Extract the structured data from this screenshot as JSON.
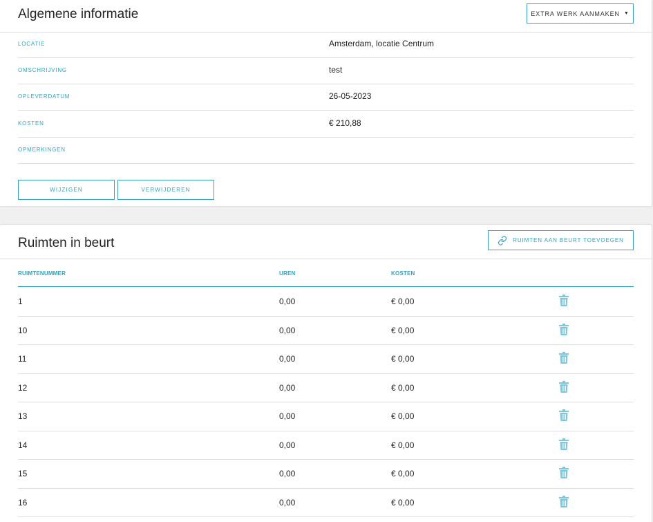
{
  "info": {
    "title": "Algemene informatie",
    "extra_button": "EXTRA WERK AANMAKEN",
    "rows": [
      {
        "label": "LOCATIE",
        "value": "Amsterdam, locatie Centrum"
      },
      {
        "label": "OMSCHRIJVING",
        "value": "test"
      },
      {
        "label": "OPLEVERDATUM",
        "value": "26-05-2023"
      },
      {
        "label": "KOSTEN",
        "value": "€ 210,88"
      },
      {
        "label": "OPMERKINGEN",
        "value": ""
      }
    ],
    "edit_button": "WIJZIGEN",
    "delete_button": "VERWIJDEREN"
  },
  "rooms": {
    "title": "Ruimten in beurt",
    "add_button": "RUIMTEN AAN BEURT TOEVOEGEN",
    "columns": [
      "RUIMTENUMMER",
      "UREN",
      "KOSTEN"
    ],
    "rows": [
      {
        "number": "1",
        "hours": "0,00",
        "cost": "€ 0,00"
      },
      {
        "number": "10",
        "hours": "0,00",
        "cost": "€ 0,00"
      },
      {
        "number": "11",
        "hours": "0,00",
        "cost": "€ 0,00"
      },
      {
        "number": "12",
        "hours": "0,00",
        "cost": "€ 0,00"
      },
      {
        "number": "13",
        "hours": "0,00",
        "cost": "€ 0,00"
      },
      {
        "number": "14",
        "hours": "0,00",
        "cost": "€ 0,00"
      },
      {
        "number": "15",
        "hours": "0,00",
        "cost": "€ 0,00"
      },
      {
        "number": "16",
        "hours": "0,00",
        "cost": "€ 0,00"
      }
    ]
  },
  "icons": {
    "caret": "caret-down-icon",
    "link": "link-icon",
    "trash": "trash-icon"
  },
  "colors": {
    "accent": "#2fa3c4",
    "trash": "#7cc7df"
  }
}
